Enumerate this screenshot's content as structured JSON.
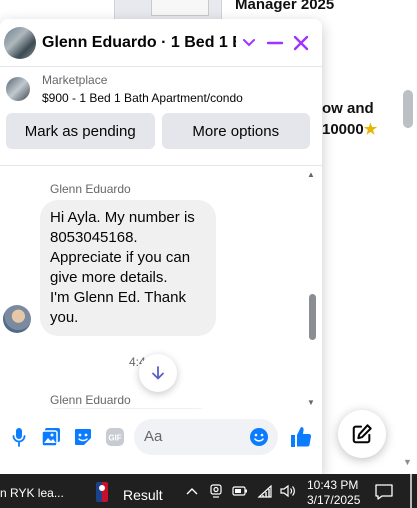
{
  "background": {
    "title": "Manager 2025",
    "subtitle": "",
    "promo_line1": "ow and",
    "promo_line2": "10000",
    "promo_star": "★"
  },
  "chat": {
    "title": "Glenn Eduardo · 1 Bed 1 Ba...",
    "listing": {
      "category": "Marketplace",
      "title": "$900 - 1 Bed 1 Bath Apartment/condo"
    },
    "actions": {
      "mark_pending": "Mark as pending",
      "more_options": "More options"
    },
    "messages": [
      {
        "sender": "Glenn Eduardo",
        "lines": [
          "Hi Ayla. My number is",
          "8053045168.",
          "Appreciate if you can",
          "give more details.",
          "I'm Glenn Ed. Thank",
          "you."
        ]
      },
      {
        "sender": "Glenn Eduardo",
        "lines": []
      }
    ],
    "timestamp": "4:4",
    "composer": {
      "placeholder": "Aa"
    }
  },
  "taskbar": {
    "app_label": "n RYK lea...",
    "result_label": "Result",
    "time": "10:43 PM",
    "date": "3/17/2025"
  },
  "colors": {
    "accent": "#a033ff",
    "messenger_blue": "#0a7cff",
    "taskbar": "#202020"
  },
  "icons": [
    "close-icon",
    "minimize-icon",
    "chevron-down-icon",
    "arrow-down-icon",
    "microphone-icon",
    "photo-icon",
    "sticker-icon",
    "gif-icon",
    "emoji-icon",
    "thumbs-up-icon",
    "compose-icon",
    "chevron-up-icon",
    "camera-icon",
    "battery-icon",
    "wifi-icon",
    "volume-icon",
    "notification-icon"
  ]
}
